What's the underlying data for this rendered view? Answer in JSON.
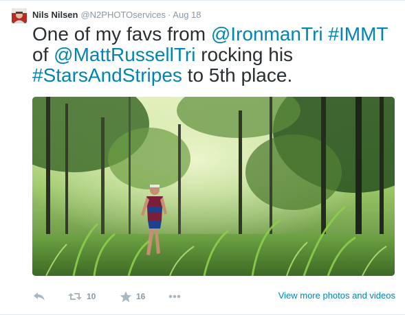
{
  "tweet": {
    "author_name": "Nils Nilsen",
    "author_handle": "@N2PHOTOservices",
    "separator": "·",
    "timestamp": "Aug 18",
    "text_segments": [
      {
        "type": "text",
        "value": "One of my favs from "
      },
      {
        "type": "mention",
        "value": "@IronmanTri"
      },
      {
        "type": "text",
        "value": " "
      },
      {
        "type": "hashtag",
        "value": "#IMMT"
      },
      {
        "type": "text",
        "value": " of "
      },
      {
        "type": "mention",
        "value": "@MattRussellTri"
      },
      {
        "type": "text",
        "value": " rocking his "
      },
      {
        "type": "hashtag",
        "value": "#StarsAndStripes"
      },
      {
        "type": "text",
        "value": " to 5th place."
      }
    ],
    "media": {
      "subject": "triathlete-running-through-forest",
      "dominant_colors": [
        "#2f5a2a",
        "#5f8f3e",
        "#a7d36d",
        "#dfeeb8"
      ]
    },
    "actions": {
      "reply_icon": "reply-icon",
      "retweet_icon": "retweet-icon",
      "retweet_count": "10",
      "favorite_icon": "star-icon",
      "favorite_count": "16",
      "more_icon": "more-dots-icon"
    },
    "view_more_label": "View more photos and videos"
  },
  "colors": {
    "link": "#0084b4",
    "text": "#292f33",
    "muted": "#8899a6",
    "icon": "#aab8c2"
  }
}
